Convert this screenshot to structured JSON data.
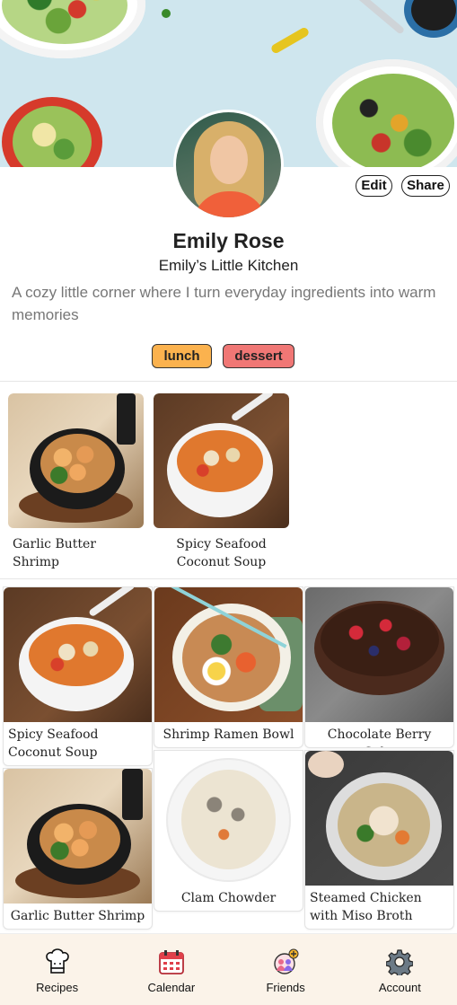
{
  "profile": {
    "name": "Emily Rose",
    "kitchen_name": "Emily’s Little Kitchen",
    "bio": "A cozy little corner where I turn everyday ingredients into warm memories",
    "edit_label": "Edit",
    "share_label": "Share",
    "tags": [
      {
        "label": "lunch",
        "color": "#fbb24e"
      },
      {
        "label": "dessert",
        "color": "#f07775"
      }
    ]
  },
  "featured": [
    {
      "title": "Garlic Butter Shrimp",
      "image": "garlic-butter-shrimp"
    },
    {
      "title": "Spicy Seafood Coconut Soup",
      "image": "spicy-seafood-coconut-soup"
    }
  ],
  "recipes": [
    {
      "title": "Spicy Seafood Coconut Soup",
      "image": "spicy-seafood-coconut-soup"
    },
    {
      "title": "Shrimp Ramen Bowl",
      "image": "shrimp-ramen-bowl"
    },
    {
      "title": "Chocolate Berry Cake",
      "image": "chocolate-berry-cake"
    },
    {
      "title": "Garlic Butter Shrimp",
      "image": "garlic-butter-shrimp"
    },
    {
      "title": "Clam Chowder",
      "image": "clam-chowder"
    },
    {
      "title": "Steamed Chicken with Miso Broth",
      "image": "steamed-chicken-miso"
    }
  ],
  "nav": [
    {
      "label": "Recipes",
      "icon": "chef-hat-icon"
    },
    {
      "label": "Calendar",
      "icon": "calendar-icon"
    },
    {
      "label": "Friends",
      "icon": "friends-add-icon"
    },
    {
      "label": "Account",
      "icon": "gear-icon"
    }
  ]
}
